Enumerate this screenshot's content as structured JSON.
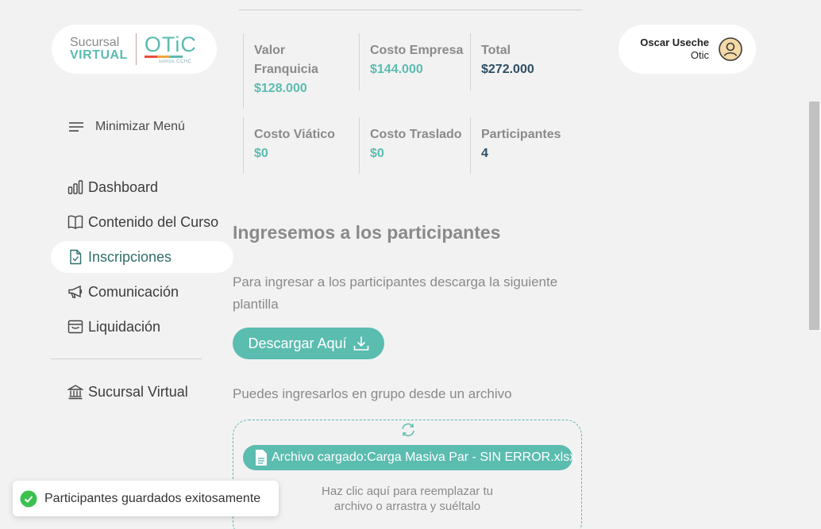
{
  "logo": {
    "sucursal": "Sucursal",
    "virtual": "VIRTUAL",
    "otic": "OTiC",
    "sub": "somos CCHC"
  },
  "menu": {
    "toggle_label": "Minimizar Menú"
  },
  "sidebar": {
    "items": [
      {
        "label": "Dashboard",
        "icon": "bar-chart-icon"
      },
      {
        "label": "Contenido del Curso",
        "icon": "book-icon"
      },
      {
        "label": "Inscripciones",
        "icon": "file-check-icon",
        "active": true
      },
      {
        "label": "Comunicación",
        "icon": "megaphone-icon"
      },
      {
        "label": "Liquidación",
        "icon": "archive-icon"
      }
    ],
    "bottom_item": {
      "label": "Sucursal Virtual",
      "icon": "bank-icon"
    }
  },
  "stats": [
    {
      "label": "Valor Franquicia",
      "value": "$128.000",
      "color": "#5bbcb0"
    },
    {
      "label": "Costo Empresa",
      "value": "$144.000",
      "color": "#5bbcb0"
    },
    {
      "label": "Total",
      "value": "$272.000",
      "color": "#2d4f66"
    },
    {
      "label": "Costo Viático",
      "value": "$0",
      "color": "#5bbcb0"
    },
    {
      "label": "Costo Traslado",
      "value": "$0",
      "color": "#5bbcb0"
    },
    {
      "label": "Participantes",
      "value": "4",
      "color": "#2d4f66"
    }
  ],
  "main": {
    "title": "Ingresemos a los participantes",
    "instructions": "Para ingresar a los participantes descarga la siguiente plantilla",
    "download_label": "Descargar Aquí",
    "group_text": "Puedes ingresarlos en grupo desde un archivo",
    "file_loaded": "Archivo cargado:Carga Masiva Par - SIN ERROR.xlsx",
    "replace_line1": "Haz clic aquí para reemplazar tu",
    "replace_line2": "archivo o arrastra y suéltalo"
  },
  "user": {
    "name": "Oscar Useche",
    "org": "Otic"
  },
  "toast": {
    "message": "Participantes guardados exitosamente"
  },
  "colors": {
    "accent": "#5bbcb0",
    "dark": "#2d4f66",
    "success": "#3cc14e"
  }
}
